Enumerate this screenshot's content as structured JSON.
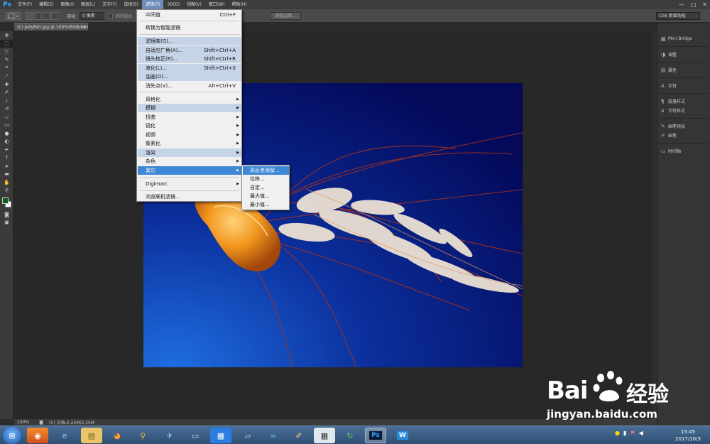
{
  "app": {
    "logo": "Ps",
    "menus": [
      {
        "label": "文件(F)"
      },
      {
        "label": "编辑(E)"
      },
      {
        "label": "图像(I)"
      },
      {
        "label": "图层(L)"
      },
      {
        "label": "文字(Y)"
      },
      {
        "label": "选择(S)"
      },
      {
        "label": "滤镜(T)",
        "active": true
      },
      {
        "label": "3D(D)"
      },
      {
        "label": "视图(V)"
      },
      {
        "label": "窗口(W)"
      },
      {
        "label": "帮助(H)"
      }
    ],
    "window_controls": [
      "—",
      "□",
      "✕"
    ]
  },
  "options_bar": {
    "feather_label": "羽化:",
    "feather_value": "0 像素",
    "antialias_label": "消除锯齿",
    "refine_edge_label": "调整边缘...",
    "workspace": "CS6 新增功能"
  },
  "document": {
    "tab_title": "(C) Jellyfish.jpg @ 100%(RGB/8#)",
    "close": "×",
    "zoom": "100%",
    "doc_size": "(C) 文档:2.25M/2.25M"
  },
  "filter_menu": {
    "items": [
      {
        "label": "中间值",
        "shortcut": "Ctrl+F"
      },
      {
        "label": "转换为智能滤镜"
      },
      {
        "label": "滤镜库(G)...",
        "highlight": true
      },
      {
        "label": "自适应广角(A)...",
        "shortcut": "Shift+Ctrl+A",
        "highlight": true
      },
      {
        "label": "镜头校正(R)...",
        "shortcut": "Shift+Ctrl+R",
        "highlight": true
      },
      {
        "label": "液化(L)...",
        "shortcut": "Shift+Ctrl+X",
        "highlight": true
      },
      {
        "label": "油画(O)...",
        "highlight": true
      },
      {
        "label": "消失点(V)...",
        "shortcut": "Alt+Ctrl+V"
      },
      {
        "label": "风格化",
        "submenu": true
      },
      {
        "label": "模糊",
        "submenu": true,
        "highlight": true
      },
      {
        "label": "扭曲",
        "submenu": true
      },
      {
        "label": "锐化",
        "submenu": true
      },
      {
        "label": "视频",
        "submenu": true
      },
      {
        "label": "像素化",
        "submenu": true
      },
      {
        "label": "渲染",
        "submenu": true,
        "highlight": true
      },
      {
        "label": "杂色",
        "submenu": true
      },
      {
        "label": "其它",
        "submenu": true,
        "selected": true
      },
      {
        "label": "Digimarc",
        "submenu": true
      },
      {
        "label": "浏览联机滤镜..."
      }
    ]
  },
  "other_submenu": {
    "items": [
      {
        "label": "高反差保留...",
        "selected": true
      },
      {
        "label": "位移..."
      },
      {
        "label": "自定..."
      },
      {
        "label": "最大值..."
      },
      {
        "label": "最小值..."
      }
    ]
  },
  "panels": [
    {
      "icon": "mini-bridge-icon",
      "label": "Mini Bridge"
    },
    {
      "icon": "adjustments-icon",
      "label": "调整"
    },
    {
      "icon": "properties-icon",
      "label": "属性"
    },
    {
      "icon": "character-icon",
      "label": "字符"
    },
    {
      "icon": "paragraph-style-icon",
      "label": "段落样式"
    },
    {
      "icon": "character-style-icon",
      "label": "字符样式"
    },
    {
      "icon": "brush-preset-icon",
      "label": "画笔预设"
    },
    {
      "icon": "brush-icon",
      "label": "画笔"
    },
    {
      "icon": "timeline-icon",
      "label": "时间轴"
    }
  ],
  "taskbar": {
    "apps": [
      {
        "icon": "windows-start-icon"
      },
      {
        "icon": "media-player-icon"
      },
      {
        "icon": "internet-explorer-icon"
      },
      {
        "icon": "file-explorer-icon"
      },
      {
        "icon": "firefox-icon"
      },
      {
        "icon": "search-app-icon"
      },
      {
        "icon": "feiniu-icon"
      },
      {
        "icon": "remote-desktop-icon"
      },
      {
        "icon": "tiles-app-icon"
      },
      {
        "icon": "notebook-app-icon"
      },
      {
        "icon": "baidu-netdisk-icon"
      },
      {
        "icon": "paint-app-icon"
      },
      {
        "icon": "calculator-icon"
      },
      {
        "icon": "refresh-app-icon"
      },
      {
        "icon": "photoshop-icon",
        "label": "Ps",
        "active": true
      },
      {
        "icon": "wps-icon",
        "label": "W"
      }
    ],
    "time": "15:45",
    "date": "2017/10/3"
  },
  "watermark": {
    "brand": "Bai",
    "brand_suffix": "经验",
    "url": "jingyan.baidu.com"
  },
  "colors": {
    "menu_selected": "#3e86d6",
    "menu_highlight": "#c6d4e8",
    "ps_blue": "#31a8ff"
  }
}
